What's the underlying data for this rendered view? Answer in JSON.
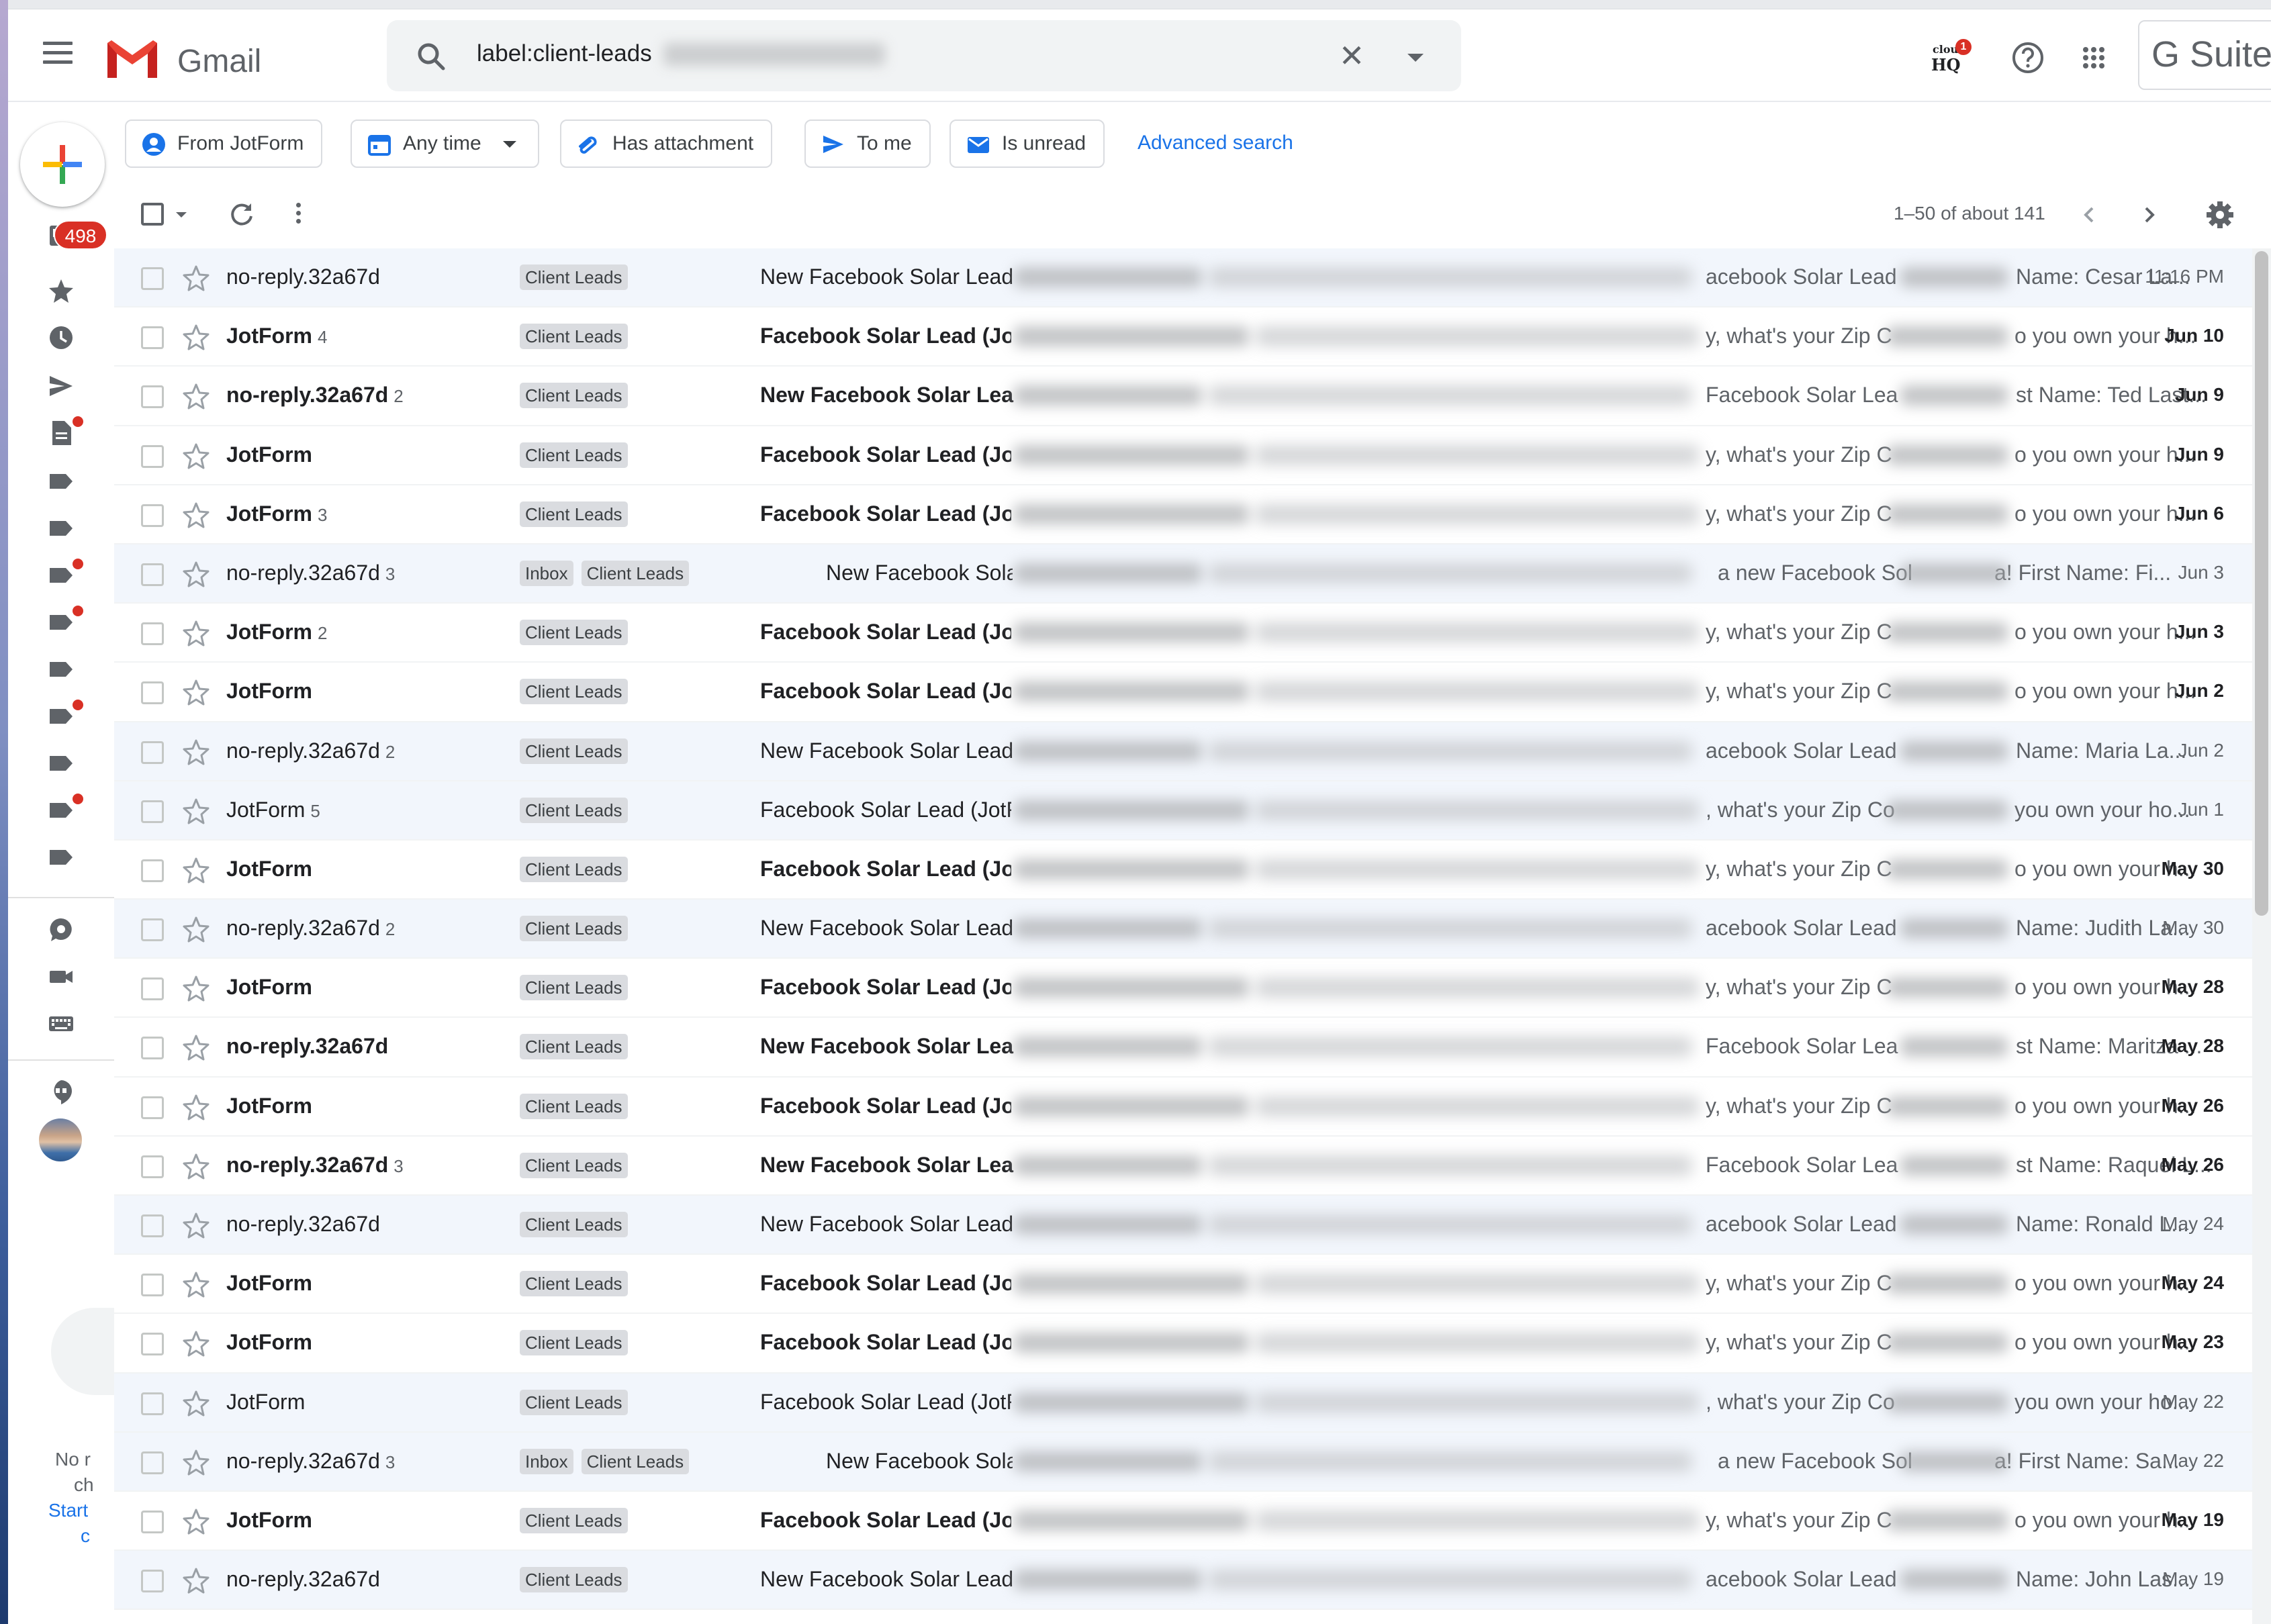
{
  "app": {
    "logo_text": "Gmail",
    "brand_right": "G Suite"
  },
  "search": {
    "query": "label:client-leads",
    "icon": "search-icon",
    "clear_icon": "close-icon",
    "options_icon": "caret-down-icon"
  },
  "header": {
    "cloudhq_top": "cloud",
    "cloudhq_bottom": "HQ",
    "cloudhq_badge": "1",
    "help_icon": "help-icon",
    "apps_icon": "apps-grid-icon"
  },
  "filters": [
    {
      "label": "From JotForm",
      "icon": "person-icon"
    },
    {
      "label": "Any time",
      "icon": "calendar-icon"
    },
    {
      "label": "Has attachment",
      "icon": "paperclip-icon"
    },
    {
      "label": "To me",
      "icon": "send-icon"
    },
    {
      "label": "Is unread",
      "icon": "unread-mail-icon"
    }
  ],
  "advanced_search": "Advanced search",
  "rail": {
    "inbox_badge": "498",
    "hangouts_text_1": "No r",
    "hangouts_text_2": "ch",
    "hangouts_link": "Start",
    "hangouts_text_3": "c"
  },
  "toolbar": {
    "count": "1–50 of about 141"
  },
  "emails": [
    {
      "sender": "no-reply.32a67d",
      "count": "",
      "labels": [
        "Client Leads"
      ],
      "subject": "New Facebook Solar Lead ·",
      "frag1": "acebook Solar Lead",
      "frag2": "Name: Cesar La...",
      "date": "11:16 PM",
      "unread": false,
      "type": "fb"
    },
    {
      "sender": "JotForm",
      "count": "4",
      "labels": [
        "Client Leads"
      ],
      "subject": "Facebook Solar Lead (JotF",
      "frag1": "y, what's your Zip C",
      "frag2": "o you own your h...",
      "date": "Jun 10",
      "unread": true,
      "type": "jf"
    },
    {
      "sender": "no-reply.32a67d",
      "count": "2",
      "labels": [
        "Client Leads"
      ],
      "subject": "New Facebook Solar Lead",
      "frag1": "Facebook Solar Lea",
      "frag2": "st Name: Ted Last...",
      "date": "Jun 9",
      "unread": true,
      "type": "fb"
    },
    {
      "sender": "JotForm",
      "count": "",
      "labels": [
        "Client Leads"
      ],
      "subject": "Facebook Solar Lead (JotF",
      "frag1": "y, what's your Zip C",
      "frag2": "o you own your h...",
      "date": "Jun 9",
      "unread": true,
      "type": "jf"
    },
    {
      "sender": "JotForm",
      "count": "3",
      "labels": [
        "Client Leads"
      ],
      "subject": "Facebook Solar Lead (JotF",
      "frag1": "y, what's your Zip C",
      "frag2": "o you own your h...",
      "date": "Jun 6",
      "unread": true,
      "type": "jf"
    },
    {
      "sender": "no-reply.32a67d",
      "count": "3",
      "labels": [
        "Inbox",
        "Client Leads"
      ],
      "subject": "New Facebook Sola",
      "frag1": "a new Facebook Sol",
      "frag2": "a! First Name: Fi...",
      "date": "Jun 3",
      "unread": false,
      "type": "fb2"
    },
    {
      "sender": "JotForm",
      "count": "2",
      "labels": [
        "Client Leads"
      ],
      "subject": "Facebook Solar Lead (JotF",
      "frag1": "y, what's your Zip C",
      "frag2": "o you own your h...",
      "date": "Jun 3",
      "unread": true,
      "type": "jf"
    },
    {
      "sender": "JotForm",
      "count": "",
      "labels": [
        "Client Leads"
      ],
      "subject": "Facebook Solar Lead (JotF",
      "frag1": "y, what's your Zip C",
      "frag2": "o you own your h...",
      "date": "Jun 2",
      "unread": true,
      "type": "jf"
    },
    {
      "sender": "no-reply.32a67d",
      "count": "2",
      "labels": [
        "Client Leads"
      ],
      "subject": "New Facebook Solar Lead ·",
      "frag1": "acebook Solar Lead",
      "frag2": "Name: Maria La...",
      "date": "Jun 2",
      "unread": false,
      "type": "fb"
    },
    {
      "sender": "JotForm",
      "count": "5",
      "labels": [
        "Client Leads"
      ],
      "subject": "Facebook Solar Lead (JotF",
      "frag1": ", what's your Zip Co",
      "frag2": "you own your ho...",
      "date": "Jun 1",
      "unread": false,
      "type": "jf"
    },
    {
      "sender": "JotForm",
      "count": "",
      "labels": [
        "Client Leads"
      ],
      "subject": "Facebook Solar Lead (JotF",
      "frag1": "y, what's your Zip C",
      "frag2": "o you own your h...",
      "date": "May 30",
      "unread": true,
      "type": "jf"
    },
    {
      "sender": "no-reply.32a67d",
      "count": "2",
      "labels": [
        "Client Leads"
      ],
      "subject": "New Facebook Solar Lead ·",
      "frag1": "acebook Solar Lead",
      "frag2": "Name: Judith La...",
      "date": "May 30",
      "unread": false,
      "type": "fb"
    },
    {
      "sender": "JotForm",
      "count": "",
      "labels": [
        "Client Leads"
      ],
      "subject": "Facebook Solar Lead (JotF",
      "frag1": "y, what's your Zip C",
      "frag2": "o you own your h...",
      "date": "May 28",
      "unread": true,
      "type": "jf"
    },
    {
      "sender": "no-reply.32a67d",
      "count": "",
      "labels": [
        "Client Leads"
      ],
      "subject": "New Facebook Solar Lead",
      "frag1": "Facebook Solar Lea",
      "frag2": "st Name: Maritza ...",
      "date": "May 28",
      "unread": true,
      "type": "fb"
    },
    {
      "sender": "JotForm",
      "count": "",
      "labels": [
        "Client Leads"
      ],
      "subject": "Facebook Solar Lead (JotF",
      "frag1": "y, what's your Zip C",
      "frag2": "o you own your h...",
      "date": "May 26",
      "unread": true,
      "type": "jf"
    },
    {
      "sender": "no-reply.32a67d",
      "count": "3",
      "labels": [
        "Client Leads"
      ],
      "subject": "New Facebook Solar Lead",
      "frag1": "Facebook Solar Lea",
      "frag2": "st Name: Raquel L...",
      "date": "May 26",
      "unread": true,
      "type": "fb"
    },
    {
      "sender": "no-reply.32a67d",
      "count": "",
      "labels": [
        "Client Leads"
      ],
      "subject": "New Facebook Solar Lead ·",
      "frag1": "acebook Solar Lead",
      "frag2": "Name: Ronald L...",
      "date": "May 24",
      "unread": false,
      "type": "fb"
    },
    {
      "sender": "JotForm",
      "count": "",
      "labels": [
        "Client Leads"
      ],
      "subject": "Facebook Solar Lead (JotF",
      "frag1": "y, what's your Zip C",
      "frag2": "o you own your h...",
      "date": "May 24",
      "unread": true,
      "type": "jf"
    },
    {
      "sender": "JotForm",
      "count": "",
      "labels": [
        "Client Leads"
      ],
      "subject": "Facebook Solar Lead (JotF",
      "frag1": "y, what's your Zip C",
      "frag2": "o you own your h...",
      "date": "May 23",
      "unread": true,
      "type": "jf"
    },
    {
      "sender": "JotForm",
      "count": "",
      "labels": [
        "Client Leads"
      ],
      "subject": "Facebook Solar Lead (JotF",
      "frag1": ", what's your Zip Co",
      "frag2": "you own your ho...",
      "date": "May 22",
      "unread": false,
      "type": "jf"
    },
    {
      "sender": "no-reply.32a67d",
      "count": "3",
      "labels": [
        "Inbox",
        "Client Leads"
      ],
      "subject": "New Facebook Sola",
      "frag1": "a new Facebook Sol",
      "frag2": "a! First Name: Sa...",
      "date": "May 22",
      "unread": false,
      "type": "fb2"
    },
    {
      "sender": "JotForm",
      "count": "",
      "labels": [
        "Client Leads"
      ],
      "subject": "Facebook Solar Lead (JotF",
      "frag1": "y, what's your Zip C",
      "frag2": "o you own your h...",
      "date": "May 19",
      "unread": true,
      "type": "jf"
    },
    {
      "sender": "no-reply.32a67d",
      "count": "",
      "labels": [
        "Client Leads"
      ],
      "subject": "New Facebook Solar Lead ·",
      "frag1": "acebook Solar Lead",
      "frag2": "Name: John Las...",
      "date": "May 19",
      "unread": false,
      "type": "fb"
    }
  ]
}
